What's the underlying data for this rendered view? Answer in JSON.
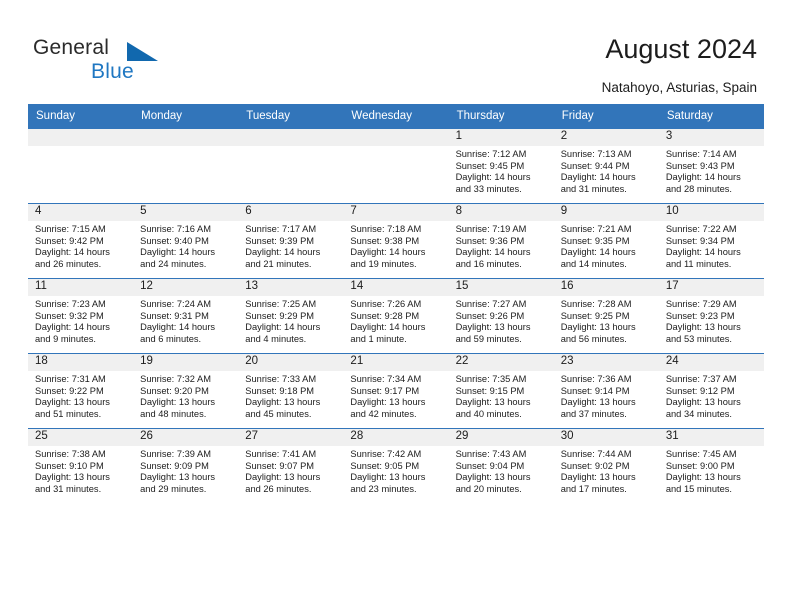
{
  "brand": {
    "name_part1": "General",
    "name_part2": "Blue",
    "triangle_color": "#1168ae",
    "blue_color": "#1f77c2"
  },
  "header": {
    "title": "August 2024",
    "location": "Natahoyo, Asturias, Spain"
  },
  "colors": {
    "header_blue": "#3275ba",
    "daynum_band": "#f0f0f0",
    "text": "#1c1c1c"
  },
  "weekdays": [
    "Sunday",
    "Monday",
    "Tuesday",
    "Wednesday",
    "Thursday",
    "Friday",
    "Saturday"
  ],
  "labels": {
    "sunrise_prefix": "Sunrise:",
    "sunset_prefix": "Sunset:",
    "daylight_prefix": "Daylight:"
  },
  "weeks": [
    [
      {
        "day": "",
        "l1": "",
        "l2": "",
        "l3": "",
        "l4": ""
      },
      {
        "day": "",
        "l1": "",
        "l2": "",
        "l3": "",
        "l4": ""
      },
      {
        "day": "",
        "l1": "",
        "l2": "",
        "l3": "",
        "l4": ""
      },
      {
        "day": "",
        "l1": "",
        "l2": "",
        "l3": "",
        "l4": ""
      },
      {
        "day": "1",
        "l1": "Sunrise: 7:12 AM",
        "l2": "Sunset: 9:45 PM",
        "l3": "Daylight: 14 hours",
        "l4": "and 33 minutes."
      },
      {
        "day": "2",
        "l1": "Sunrise: 7:13 AM",
        "l2": "Sunset: 9:44 PM",
        "l3": "Daylight: 14 hours",
        "l4": "and 31 minutes."
      },
      {
        "day": "3",
        "l1": "Sunrise: 7:14 AM",
        "l2": "Sunset: 9:43 PM",
        "l3": "Daylight: 14 hours",
        "l4": "and 28 minutes."
      }
    ],
    [
      {
        "day": "4",
        "l1": "Sunrise: 7:15 AM",
        "l2": "Sunset: 9:42 PM",
        "l3": "Daylight: 14 hours",
        "l4": "and 26 minutes."
      },
      {
        "day": "5",
        "l1": "Sunrise: 7:16 AM",
        "l2": "Sunset: 9:40 PM",
        "l3": "Daylight: 14 hours",
        "l4": "and 24 minutes."
      },
      {
        "day": "6",
        "l1": "Sunrise: 7:17 AM",
        "l2": "Sunset: 9:39 PM",
        "l3": "Daylight: 14 hours",
        "l4": "and 21 minutes."
      },
      {
        "day": "7",
        "l1": "Sunrise: 7:18 AM",
        "l2": "Sunset: 9:38 PM",
        "l3": "Daylight: 14 hours",
        "l4": "and 19 minutes."
      },
      {
        "day": "8",
        "l1": "Sunrise: 7:19 AM",
        "l2": "Sunset: 9:36 PM",
        "l3": "Daylight: 14 hours",
        "l4": "and 16 minutes."
      },
      {
        "day": "9",
        "l1": "Sunrise: 7:21 AM",
        "l2": "Sunset: 9:35 PM",
        "l3": "Daylight: 14 hours",
        "l4": "and 14 minutes."
      },
      {
        "day": "10",
        "l1": "Sunrise: 7:22 AM",
        "l2": "Sunset: 9:34 PM",
        "l3": "Daylight: 14 hours",
        "l4": "and 11 minutes."
      }
    ],
    [
      {
        "day": "11",
        "l1": "Sunrise: 7:23 AM",
        "l2": "Sunset: 9:32 PM",
        "l3": "Daylight: 14 hours",
        "l4": "and 9 minutes."
      },
      {
        "day": "12",
        "l1": "Sunrise: 7:24 AM",
        "l2": "Sunset: 9:31 PM",
        "l3": "Daylight: 14 hours",
        "l4": "and 6 minutes."
      },
      {
        "day": "13",
        "l1": "Sunrise: 7:25 AM",
        "l2": "Sunset: 9:29 PM",
        "l3": "Daylight: 14 hours",
        "l4": "and 4 minutes."
      },
      {
        "day": "14",
        "l1": "Sunrise: 7:26 AM",
        "l2": "Sunset: 9:28 PM",
        "l3": "Daylight: 14 hours",
        "l4": "and 1 minute."
      },
      {
        "day": "15",
        "l1": "Sunrise: 7:27 AM",
        "l2": "Sunset: 9:26 PM",
        "l3": "Daylight: 13 hours",
        "l4": "and 59 minutes."
      },
      {
        "day": "16",
        "l1": "Sunrise: 7:28 AM",
        "l2": "Sunset: 9:25 PM",
        "l3": "Daylight: 13 hours",
        "l4": "and 56 minutes."
      },
      {
        "day": "17",
        "l1": "Sunrise: 7:29 AM",
        "l2": "Sunset: 9:23 PM",
        "l3": "Daylight: 13 hours",
        "l4": "and 53 minutes."
      }
    ],
    [
      {
        "day": "18",
        "l1": "Sunrise: 7:31 AM",
        "l2": "Sunset: 9:22 PM",
        "l3": "Daylight: 13 hours",
        "l4": "and 51 minutes."
      },
      {
        "day": "19",
        "l1": "Sunrise: 7:32 AM",
        "l2": "Sunset: 9:20 PM",
        "l3": "Daylight: 13 hours",
        "l4": "and 48 minutes."
      },
      {
        "day": "20",
        "l1": "Sunrise: 7:33 AM",
        "l2": "Sunset: 9:18 PM",
        "l3": "Daylight: 13 hours",
        "l4": "and 45 minutes."
      },
      {
        "day": "21",
        "l1": "Sunrise: 7:34 AM",
        "l2": "Sunset: 9:17 PM",
        "l3": "Daylight: 13 hours",
        "l4": "and 42 minutes."
      },
      {
        "day": "22",
        "l1": "Sunrise: 7:35 AM",
        "l2": "Sunset: 9:15 PM",
        "l3": "Daylight: 13 hours",
        "l4": "and 40 minutes."
      },
      {
        "day": "23",
        "l1": "Sunrise: 7:36 AM",
        "l2": "Sunset: 9:14 PM",
        "l3": "Daylight: 13 hours",
        "l4": "and 37 minutes."
      },
      {
        "day": "24",
        "l1": "Sunrise: 7:37 AM",
        "l2": "Sunset: 9:12 PM",
        "l3": "Daylight: 13 hours",
        "l4": "and 34 minutes."
      }
    ],
    [
      {
        "day": "25",
        "l1": "Sunrise: 7:38 AM",
        "l2": "Sunset: 9:10 PM",
        "l3": "Daylight: 13 hours",
        "l4": "and 31 minutes."
      },
      {
        "day": "26",
        "l1": "Sunrise: 7:39 AM",
        "l2": "Sunset: 9:09 PM",
        "l3": "Daylight: 13 hours",
        "l4": "and 29 minutes."
      },
      {
        "day": "27",
        "l1": "Sunrise: 7:41 AM",
        "l2": "Sunset: 9:07 PM",
        "l3": "Daylight: 13 hours",
        "l4": "and 26 minutes."
      },
      {
        "day": "28",
        "l1": "Sunrise: 7:42 AM",
        "l2": "Sunset: 9:05 PM",
        "l3": "Daylight: 13 hours",
        "l4": "and 23 minutes."
      },
      {
        "day": "29",
        "l1": "Sunrise: 7:43 AM",
        "l2": "Sunset: 9:04 PM",
        "l3": "Daylight: 13 hours",
        "l4": "and 20 minutes."
      },
      {
        "day": "30",
        "l1": "Sunrise: 7:44 AM",
        "l2": "Sunset: 9:02 PM",
        "l3": "Daylight: 13 hours",
        "l4": "and 17 minutes."
      },
      {
        "day": "31",
        "l1": "Sunrise: 7:45 AM",
        "l2": "Sunset: 9:00 PM",
        "l3": "Daylight: 13 hours",
        "l4": "and 15 minutes."
      }
    ]
  ]
}
